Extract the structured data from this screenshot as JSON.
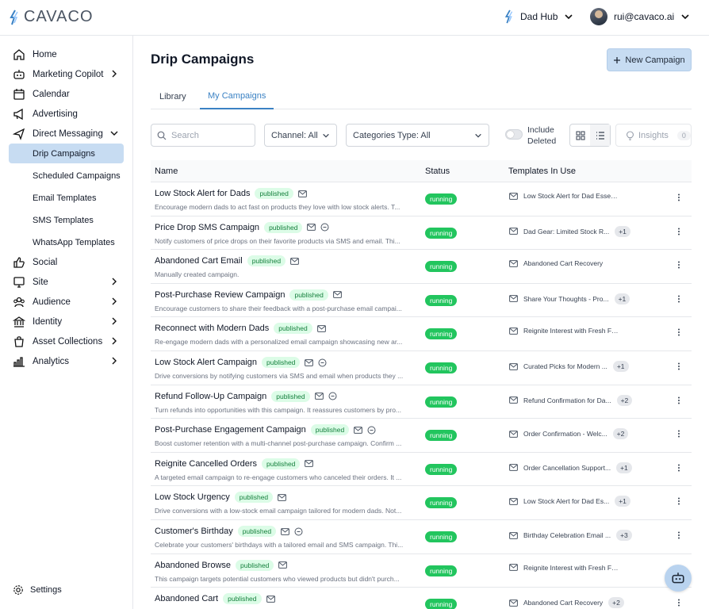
{
  "app": {
    "logo_text": "CAVACO",
    "brand_color": "#3b82c4"
  },
  "header": {
    "hub_name": "Dad Hub",
    "user_email": "rui@cavaco.ai"
  },
  "sidebar": {
    "items": [
      {
        "label": "Home",
        "icon": "home-icon"
      },
      {
        "label": "Marketing Copilot",
        "icon": "robot-icon"
      },
      {
        "label": "Calendar",
        "icon": "calendar-icon"
      },
      {
        "label": "Advertising",
        "icon": "megaphone-icon"
      },
      {
        "label": "Direct Messaging",
        "icon": "send-icon"
      },
      {
        "label": "Social",
        "icon": "thumbs-up-icon"
      },
      {
        "label": "Site",
        "icon": "monitor-icon"
      },
      {
        "label": "Audience",
        "icon": "users-icon"
      },
      {
        "label": "Identity",
        "icon": "bank-icon"
      },
      {
        "label": "Asset Collections",
        "icon": "bag-icon"
      },
      {
        "label": "Analytics",
        "icon": "bar-chart-icon"
      }
    ],
    "sub_items": [
      {
        "label": "Drip Campaigns"
      },
      {
        "label": "Scheduled Campaigns"
      },
      {
        "label": "Email Templates"
      },
      {
        "label": "SMS Templates"
      },
      {
        "label": "WhatsApp Templates"
      }
    ],
    "settings_label": "Settings"
  },
  "main": {
    "title": "Drip Campaigns",
    "new_button": "New Campaign",
    "tabs": [
      {
        "label": "Library"
      },
      {
        "label": "My Campaigns"
      }
    ],
    "filters": {
      "search_placeholder": "Search",
      "channel": "Channel: All",
      "category": "Categories Type: All",
      "include_deleted_line1": "Include",
      "include_deleted_line2": "Deleted",
      "insights_label": "Insights",
      "insights_count": "0"
    },
    "table": {
      "columns": {
        "name": "Name",
        "status": "Status",
        "templates": "Templates In Use"
      },
      "rows": [
        {
          "name": "Low Stock Alert for Dads",
          "badge": "published",
          "sms": false,
          "desc": "Encourage modern dads to act fast on products they love with low stock alerts. T...",
          "status": "running",
          "template": "Low Stock Alert for Dad Essentials",
          "extra": ""
        },
        {
          "name": "Price Drop SMS Campaign",
          "badge": "published",
          "sms": true,
          "desc": "Notify customers of price drops on their favorite products via SMS and email. Thi...",
          "status": "running",
          "template": "Dad Gear: Limited Stock R...",
          "extra": "+1"
        },
        {
          "name": "Abandoned Cart Email",
          "badge": "published",
          "sms": false,
          "desc": "Manually created campaign.",
          "status": "running",
          "template": "Abandoned Cart Recovery",
          "extra": ""
        },
        {
          "name": "Post-Purchase Review Campaign",
          "badge": "published",
          "sms": false,
          "desc": "Encourage customers to share their feedback with a post-purchase email campai...",
          "status": "running",
          "template": "Share Your Thoughts - Pro...",
          "extra": "+1"
        },
        {
          "name": "Reconnect with Modern Dads",
          "badge": "published",
          "sms": false,
          "desc": "Re-engage modern dads with a personalized email campaign showcasing new ar...",
          "status": "running",
          "template": "Reignite Interest with Fresh Finds...",
          "extra": ""
        },
        {
          "name": "Low Stock Alert Campaign",
          "badge": "published",
          "sms": true,
          "desc": "Drive conversions by notifying customers via SMS and email when products they ...",
          "status": "running",
          "template": "Curated Picks for Modern ...",
          "extra": "+1"
        },
        {
          "name": "Refund Follow-Up Campaign",
          "badge": "published",
          "sms": true,
          "desc": "Turn refunds into opportunities with this campaign. It reassures customers by pro...",
          "status": "running",
          "template": "Refund Confirmation for Da...",
          "extra": "+2"
        },
        {
          "name": "Post-Purchase Engagement Campaign",
          "badge": "published",
          "sms": true,
          "desc": "Boost customer retention with a multi-channel post-purchase campaign. Confirm ...",
          "status": "running",
          "template": "Order Confirmation - Welc...",
          "extra": "+2"
        },
        {
          "name": "Reignite Cancelled Orders",
          "badge": "published",
          "sms": false,
          "desc": "A targeted email campaign to re-engage customers who canceled their orders. It ...",
          "status": "running",
          "template": "Order Cancellation Support...",
          "extra": "+1"
        },
        {
          "name": "Low Stock Urgency",
          "badge": "published",
          "sms": false,
          "desc": "Drive conversions with a low-stock email campaign tailored for modern dads. Not...",
          "status": "running",
          "template": "Low Stock Alert for Dad Es...",
          "extra": "+1"
        },
        {
          "name": "Customer's Birthday",
          "badge": "published",
          "sms": true,
          "desc": "Celebrate your customers' birthdays with a tailored email and SMS campaign. Thi...",
          "status": "running",
          "template": "Birthday Celebration Email ...",
          "extra": "+3"
        },
        {
          "name": "Abandoned Browse",
          "badge": "published",
          "sms": false,
          "desc": "This campaign targets potential customers who viewed products but didn't purch...",
          "status": "running",
          "template": "Reignite Interest with Fresh Finds...",
          "extra": ""
        },
        {
          "name": "Abandoned Cart",
          "badge": "published",
          "sms": false,
          "desc": "",
          "status": "running",
          "template": "Abandoned Cart Recovery",
          "extra": "+2"
        }
      ]
    }
  }
}
